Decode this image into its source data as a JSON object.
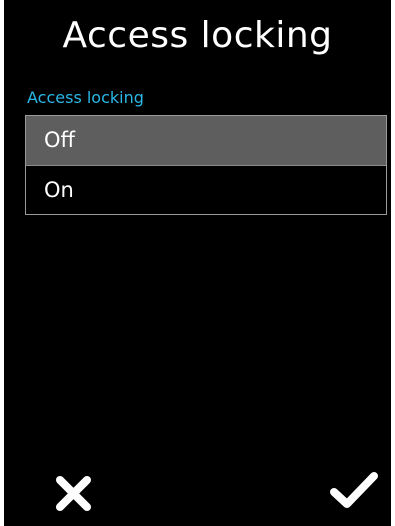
{
  "header": {
    "title": "Access locking"
  },
  "setting": {
    "label": "Access locking",
    "options": [
      {
        "label": "Off",
        "selected": true
      },
      {
        "label": "On",
        "selected": false
      }
    ]
  },
  "actions": {
    "cancel_icon": "close-icon",
    "confirm_icon": "checkmark-icon"
  },
  "colors": {
    "background": "#000000",
    "accent": "#2ab7e6",
    "selected_row": "#5e5e5e",
    "text": "#ffffff"
  }
}
